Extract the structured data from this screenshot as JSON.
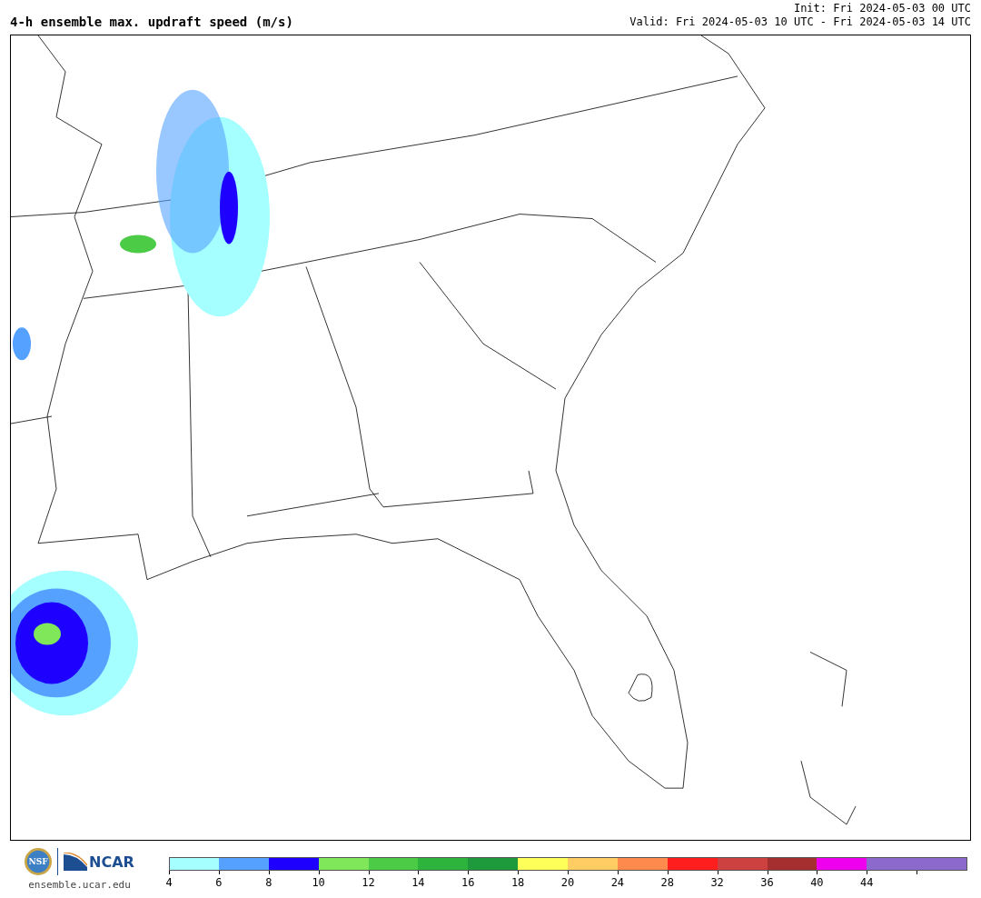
{
  "title": "4-h ensemble max. updraft speed (m/s)",
  "init": "Init: Fri 2024-05-03 00 UTC",
  "valid": "Valid: Fri 2024-05-03 10 UTC - Fri 2024-05-03 14 UTC",
  "logos": {
    "nsf": "NSF",
    "ncar": "NCAR"
  },
  "site": "ensemble.ucar.edu",
  "colorbar": [
    {
      "color": "#a6ffff",
      "label": "4"
    },
    {
      "color": "#55a1ff",
      "label": "6"
    },
    {
      "color": "#1e00ff",
      "label": "8"
    },
    {
      "color": "#80e65a",
      "label": "10"
    },
    {
      "color": "#4ccc46",
      "label": "12"
    },
    {
      "color": "#2db43c",
      "label": "14"
    },
    {
      "color": "#1e9a3c",
      "label": "16"
    },
    {
      "color": "#ffff5a",
      "label": "18"
    },
    {
      "color": "#ffcd64",
      "label": "20"
    },
    {
      "color": "#ff8a4e",
      "label": "24"
    },
    {
      "color": "#ff1e1e",
      "label": "28"
    },
    {
      "color": "#cd4141",
      "label": "32"
    },
    {
      "color": "#a52f2f",
      "label": "36"
    },
    {
      "color": "#ef00ef",
      "label": "40"
    },
    {
      "color": "#8b69cd",
      "label": "44"
    },
    {
      "color": "#8b69cd"
    }
  ]
}
